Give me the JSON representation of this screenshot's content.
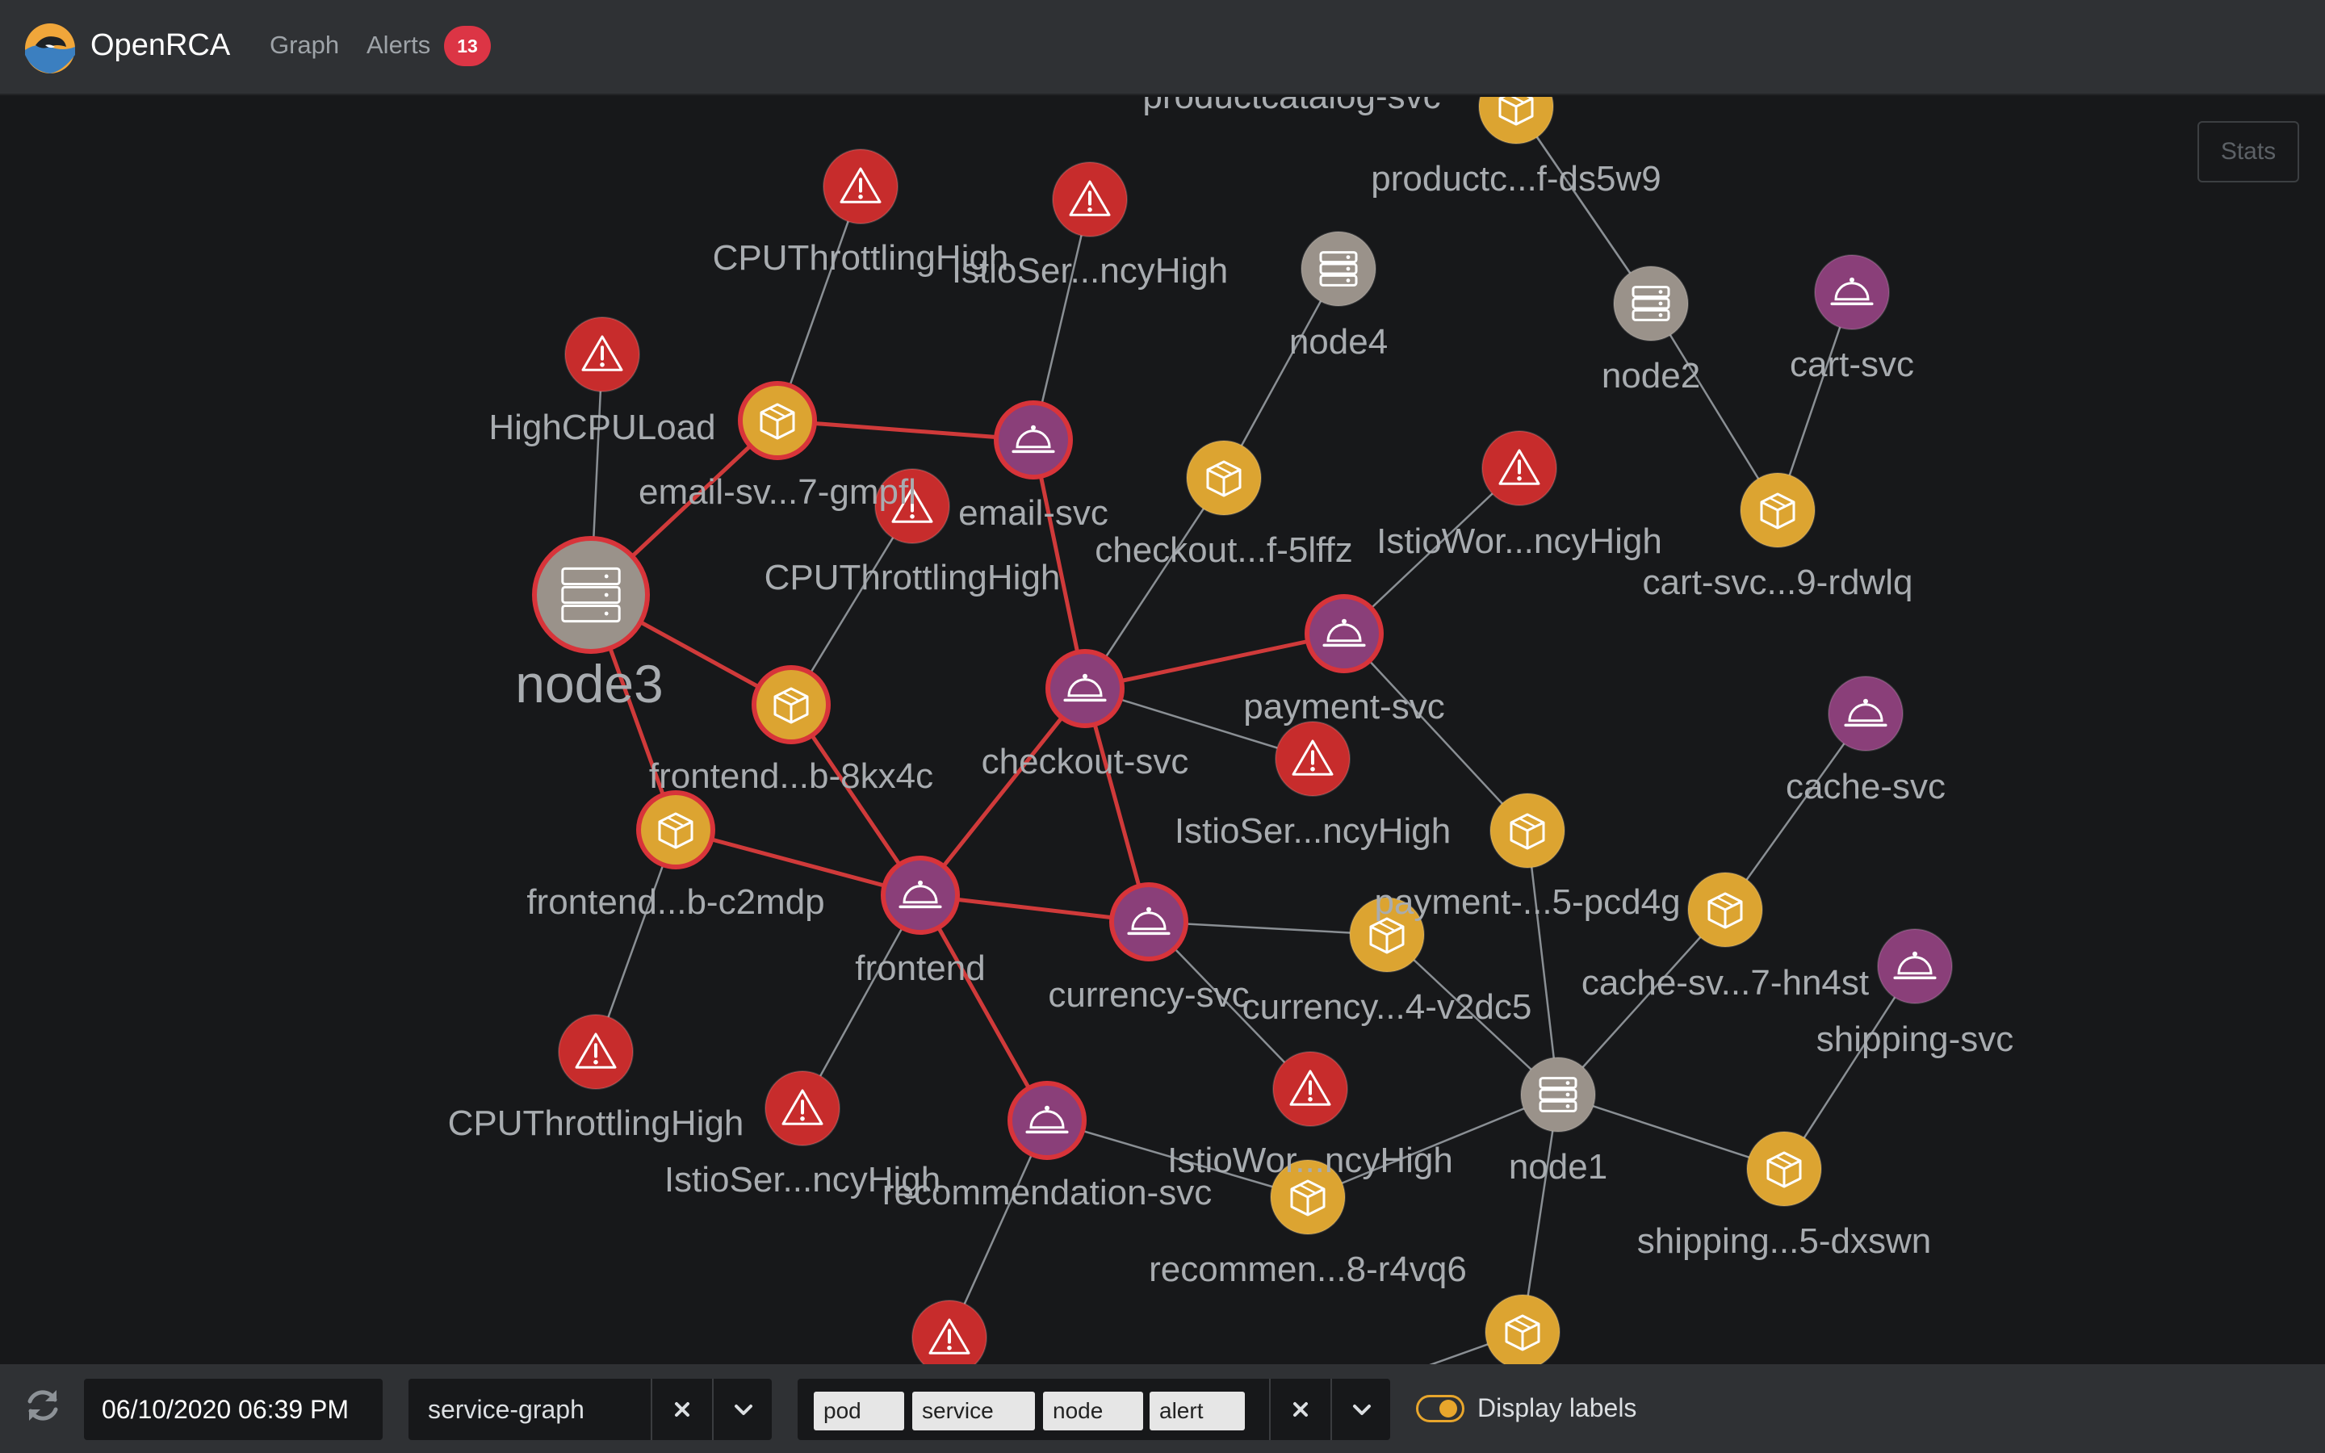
{
  "header": {
    "app_title": "OpenRCA",
    "nav": {
      "graph": "Graph",
      "alerts": "Alerts"
    },
    "alerts_count": "13"
  },
  "colors": {
    "alert": "#c72c2c",
    "pod": "#dca431",
    "service": "#8a3f79",
    "node": "#9a928a",
    "highlight_edge": "#d03a3a",
    "edge": "#8a8f94"
  },
  "icons": {
    "alert": "warning-triangle-icon",
    "pod": "cube-box-icon",
    "service": "service-bell-icon",
    "node": "server-stack-icon"
  },
  "graph": {
    "stats_label": "Stats",
    "nodes": [
      {
        "id": "node3",
        "type": "node",
        "label": "node3",
        "big": true,
        "highlight": true
      },
      {
        "id": "a-highcpu",
        "type": "alert",
        "label": "HighCPULoad"
      },
      {
        "id": "a-cputh1",
        "type": "alert",
        "label": "CPUThrottlingHigh"
      },
      {
        "id": "a-istioser1",
        "type": "alert",
        "label": "IstioSer...ncyHigh"
      },
      {
        "id": "pod-email",
        "type": "pod",
        "label": "email-sv...7-gmpfl",
        "highlight": true
      },
      {
        "id": "svc-email",
        "type": "service",
        "label": "email-svc",
        "highlight": true
      },
      {
        "id": "a-cputh2",
        "type": "alert",
        "label": "CPUThrottlingHigh"
      },
      {
        "id": "pod-frontend1",
        "type": "pod",
        "label": "frontend...b-8kx4c",
        "highlight": true
      },
      {
        "id": "pod-frontend2",
        "type": "pod",
        "label": "frontend...b-c2mdp",
        "highlight": true
      },
      {
        "id": "svc-frontend",
        "type": "service",
        "label": "frontend",
        "highlight": true
      },
      {
        "id": "a-cputh3",
        "type": "alert",
        "label": "CPUThrottlingHigh"
      },
      {
        "id": "a-istioser2",
        "type": "alert",
        "label": "IstioSer...ncyHigh"
      },
      {
        "id": "svc-recommendation",
        "type": "service",
        "label": "recommendation-svc",
        "highlight": true
      },
      {
        "id": "a-bottom",
        "type": "alert",
        "label": ""
      },
      {
        "id": "svc-checkout",
        "type": "service",
        "label": "checkout-svc",
        "highlight": true
      },
      {
        "id": "pod-checkout",
        "type": "pod",
        "label": "checkout...f-5lffz"
      },
      {
        "id": "node4",
        "type": "node",
        "label": "node4"
      },
      {
        "id": "svc-payment",
        "type": "service",
        "label": "payment-svc",
        "highlight": true
      },
      {
        "id": "a-istiowor1",
        "type": "alert",
        "label": "IstioWor...ncyHigh"
      },
      {
        "id": "a-istioser3",
        "type": "alert",
        "label": "IstioSer...ncyHigh"
      },
      {
        "id": "svc-currency",
        "type": "service",
        "label": "currency-svc",
        "highlight": true
      },
      {
        "id": "pod-currency",
        "type": "pod",
        "label": "currency...4-v2dc5"
      },
      {
        "id": "a-istiowor2",
        "type": "alert",
        "label": "IstioWor...ncyHigh"
      },
      {
        "id": "pod-recommendation",
        "type": "pod",
        "label": "recommen...8-r4vq6"
      },
      {
        "id": "pod-productcatalog",
        "type": "pod",
        "label": "productc...f-ds5w9"
      },
      {
        "id": "svc-productcatalog-label",
        "type": "label",
        "label": "productcatalog-svc"
      },
      {
        "id": "node2",
        "type": "node",
        "label": "node2"
      },
      {
        "id": "svc-cart",
        "type": "service",
        "label": "cart-svc"
      },
      {
        "id": "pod-cart",
        "type": "pod",
        "label": "cart-svc...9-rdwlq"
      },
      {
        "id": "pod-payment",
        "type": "pod",
        "label": "payment-...5-pcd4g"
      },
      {
        "id": "svc-cache",
        "type": "service",
        "label": "cache-svc"
      },
      {
        "id": "pod-cache",
        "type": "pod",
        "label": "cache-sv...7-hn4st"
      },
      {
        "id": "svc-shipping",
        "type": "service",
        "label": "shipping-svc"
      },
      {
        "id": "node1",
        "type": "node",
        "label": "node1"
      },
      {
        "id": "pod-shipping",
        "type": "pod",
        "label": "shipping...5-dxswn"
      },
      {
        "id": "pod-bottom",
        "type": "pod",
        "label": ""
      }
    ],
    "edges": [
      [
        "node3",
        "a-highcpu",
        false
      ],
      [
        "node3",
        "pod-email",
        true
      ],
      [
        "node3",
        "pod-frontend1",
        true
      ],
      [
        "node3",
        "pod-frontend2",
        true
      ],
      [
        "pod-email",
        "svc-email",
        true
      ],
      [
        "pod-email",
        "a-cputh1",
        false
      ],
      [
        "svc-email",
        "a-istioser1",
        false
      ],
      [
        "svc-email",
        "svc-checkout",
        true
      ],
      [
        "pod-frontend1",
        "a-cputh2",
        false
      ],
      [
        "pod-frontend1",
        "svc-frontend",
        true
      ],
      [
        "pod-frontend2",
        "svc-frontend",
        true
      ],
      [
        "pod-frontend2",
        "a-cputh3",
        false
      ],
      [
        "svc-frontend",
        "svc-checkout",
        true
      ],
      [
        "svc-frontend",
        "svc-currency",
        true
      ],
      [
        "svc-frontend",
        "svc-recommendation",
        true
      ],
      [
        "svc-frontend",
        "a-istioser2",
        false
      ],
      [
        "svc-checkout",
        "svc-payment",
        true
      ],
      [
        "svc-checkout",
        "svc-currency",
        true
      ],
      [
        "svc-checkout",
        "pod-checkout",
        false
      ],
      [
        "svc-checkout",
        "a-istioser3",
        false
      ],
      [
        "pod-checkout",
        "node4",
        false
      ],
      [
        "svc-payment",
        "a-istiowor1",
        false
      ],
      [
        "svc-payment",
        "pod-payment",
        false
      ],
      [
        "svc-currency",
        "pod-currency",
        false
      ],
      [
        "svc-currency",
        "a-istiowor2",
        false
      ],
      [
        "svc-recommendation",
        "pod-recommendation",
        false
      ],
      [
        "svc-recommendation",
        "a-bottom",
        false
      ],
      [
        "pod-currency",
        "node1",
        false
      ],
      [
        "pod-recommendation",
        "node1",
        false
      ],
      [
        "pod-payment",
        "node1",
        false
      ],
      [
        "pod-cache",
        "node1",
        false
      ],
      [
        "pod-shipping",
        "node1",
        false
      ],
      [
        "pod-bottom",
        "node1",
        false
      ],
      [
        "pod-cache",
        "svc-cache",
        false
      ],
      [
        "pod-shipping",
        "svc-shipping",
        false
      ],
      [
        "pod-productcatalog",
        "node2",
        false
      ],
      [
        "node2",
        "pod-cart",
        false
      ],
      [
        "pod-cart",
        "svc-cart",
        false
      ]
    ]
  },
  "toolbar": {
    "datetime": "06/10/2020 06:39 PM",
    "graph_select_value": "service-graph",
    "filter_tags": [
      "pod",
      "service",
      "node",
      "alert"
    ],
    "display_labels": "Display labels",
    "display_labels_on": true
  }
}
